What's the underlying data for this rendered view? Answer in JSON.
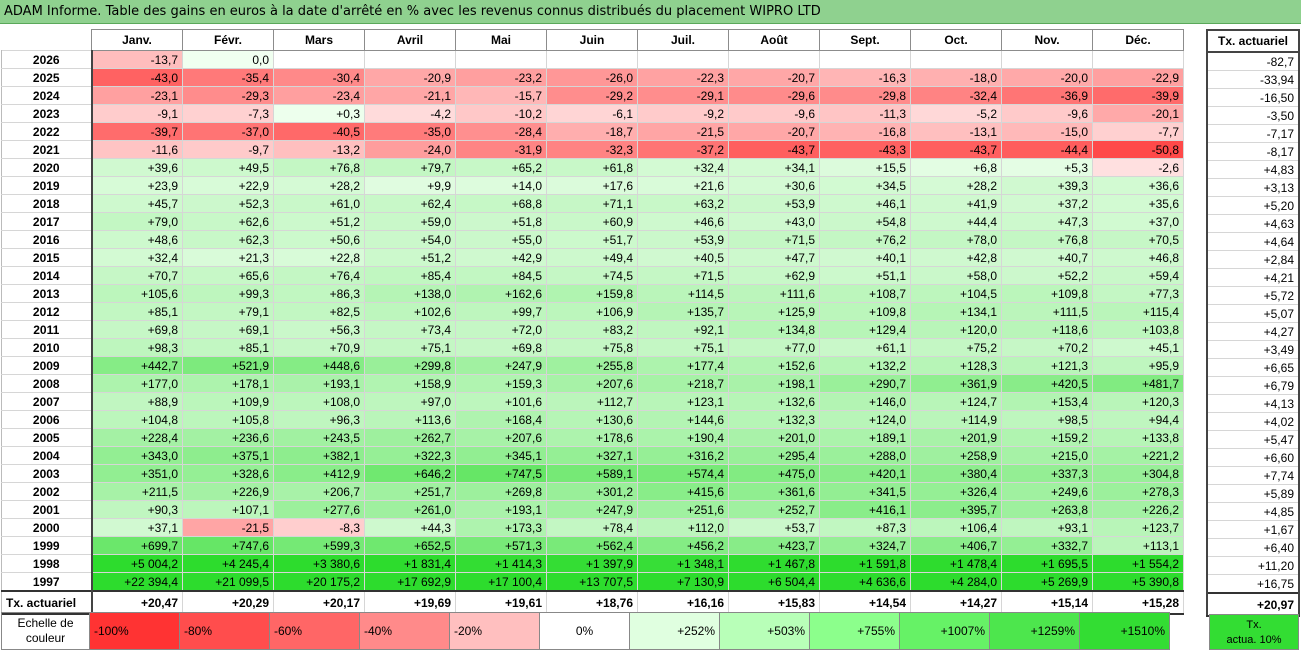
{
  "title": "ADAM Informe. Table des gains en euros à la date d'arrêté en % avec les revenus connus distribués du placement WIPRO LTD",
  "months": [
    "Janv.",
    "Févr.",
    "Mars",
    "Avril",
    "Mai",
    "Juin",
    "Juil.",
    "Août",
    "Sept.",
    "Oct.",
    "Nov.",
    "Déc."
  ],
  "side_header": "Tx. actuariel",
  "rows": [
    {
      "year": "2026",
      "v": [
        "-13,7",
        "0,0",
        "",
        "",
        "",
        "",
        "",
        "",
        "",
        "",
        "",
        ""
      ],
      "tx": "-82,7"
    },
    {
      "year": "2025",
      "v": [
        "-43,0",
        "-35,4",
        "-30,4",
        "-20,9",
        "-23,2",
        "-26,0",
        "-22,3",
        "-20,7",
        "-16,3",
        "-18,0",
        "-20,0",
        "-22,9"
      ],
      "tx": "-33,94"
    },
    {
      "year": "2024",
      "v": [
        "-23,1",
        "-29,3",
        "-23,4",
        "-21,1",
        "-15,7",
        "-29,2",
        "-29,1",
        "-29,6",
        "-29,8",
        "-32,4",
        "-36,9",
        "-39,9"
      ],
      "tx": "-16,50"
    },
    {
      "year": "2023",
      "v": [
        "-9,1",
        "-7,3",
        "+0,3",
        "-4,2",
        "-10,2",
        "-6,1",
        "-9,2",
        "-9,6",
        "-11,3",
        "-5,2",
        "-9,6",
        "-20,1"
      ],
      "tx": "-3,50"
    },
    {
      "year": "2022",
      "v": [
        "-39,7",
        "-37,0",
        "-40,5",
        "-35,0",
        "-28,4",
        "-18,7",
        "-21,5",
        "-20,7",
        "-16,8",
        "-13,1",
        "-15,0",
        "-7,7"
      ],
      "tx": "-7,17"
    },
    {
      "year": "2021",
      "v": [
        "-11,6",
        "-9,7",
        "-13,2",
        "-24,0",
        "-31,9",
        "-32,3",
        "-37,2",
        "-43,7",
        "-43,3",
        "-43,7",
        "-44,4",
        "-50,8"
      ],
      "tx": "-8,17"
    },
    {
      "year": "2020",
      "v": [
        "+39,6",
        "+49,5",
        "+76,8",
        "+79,7",
        "+65,2",
        "+61,8",
        "+32,4",
        "+34,1",
        "+15,5",
        "+6,8",
        "+5,3",
        "-2,6"
      ],
      "tx": "+4,83"
    },
    {
      "year": "2019",
      "v": [
        "+23,9",
        "+22,9",
        "+28,2",
        "+9,9",
        "+14,0",
        "+17,6",
        "+21,6",
        "+30,6",
        "+34,5",
        "+28,2",
        "+39,3",
        "+36,6"
      ],
      "tx": "+3,13"
    },
    {
      "year": "2018",
      "v": [
        "+45,7",
        "+52,3",
        "+61,0",
        "+62,4",
        "+68,8",
        "+71,1",
        "+63,2",
        "+53,9",
        "+46,1",
        "+41,9",
        "+37,2",
        "+35,6"
      ],
      "tx": "+5,20"
    },
    {
      "year": "2017",
      "v": [
        "+79,0",
        "+62,6",
        "+51,2",
        "+59,0",
        "+51,8",
        "+60,9",
        "+46,6",
        "+43,0",
        "+54,8",
        "+44,4",
        "+47,3",
        "+37,0"
      ],
      "tx": "+4,63"
    },
    {
      "year": "2016",
      "v": [
        "+48,6",
        "+62,3",
        "+50,6",
        "+54,0",
        "+55,0",
        "+51,7",
        "+53,9",
        "+71,5",
        "+76,2",
        "+78,0",
        "+76,8",
        "+70,5"
      ],
      "tx": "+4,64"
    },
    {
      "year": "2015",
      "v": [
        "+32,4",
        "+21,3",
        "+22,8",
        "+51,2",
        "+42,9",
        "+49,4",
        "+40,5",
        "+47,7",
        "+40,1",
        "+42,8",
        "+40,7",
        "+46,8"
      ],
      "tx": "+2,84"
    },
    {
      "year": "2014",
      "v": [
        "+70,7",
        "+65,6",
        "+76,4",
        "+85,4",
        "+84,5",
        "+74,5",
        "+71,5",
        "+62,9",
        "+51,1",
        "+58,0",
        "+52,2",
        "+59,4"
      ],
      "tx": "+4,21"
    },
    {
      "year": "2013",
      "v": [
        "+105,6",
        "+99,3",
        "+86,3",
        "+138,0",
        "+162,6",
        "+159,8",
        "+114,5",
        "+111,6",
        "+108,7",
        "+104,5",
        "+109,8",
        "+77,3"
      ],
      "tx": "+5,72"
    },
    {
      "year": "2012",
      "v": [
        "+85,1",
        "+79,1",
        "+82,5",
        "+102,6",
        "+99,7",
        "+106,9",
        "+135,7",
        "+125,9",
        "+109,8",
        "+134,1",
        "+111,5",
        "+115,4"
      ],
      "tx": "+5,07"
    },
    {
      "year": "2011",
      "v": [
        "+69,8",
        "+69,1",
        "+56,3",
        "+73,4",
        "+72,0",
        "+83,2",
        "+92,1",
        "+134,8",
        "+129,4",
        "+120,0",
        "+118,6",
        "+103,8"
      ],
      "tx": "+4,27"
    },
    {
      "year": "2010",
      "v": [
        "+98,3",
        "+85,1",
        "+70,9",
        "+75,1",
        "+69,8",
        "+75,8",
        "+75,1",
        "+77,0",
        "+61,1",
        "+75,2",
        "+70,2",
        "+45,1"
      ],
      "tx": "+3,49"
    },
    {
      "year": "2009",
      "v": [
        "+442,7",
        "+521,9",
        "+448,6",
        "+299,8",
        "+247,9",
        "+255,8",
        "+177,4",
        "+152,6",
        "+132,2",
        "+128,3",
        "+121,3",
        "+95,9"
      ],
      "tx": "+6,65"
    },
    {
      "year": "2008",
      "v": [
        "+177,0",
        "+178,1",
        "+193,1",
        "+158,9",
        "+159,3",
        "+207,6",
        "+218,7",
        "+198,1",
        "+290,7",
        "+361,9",
        "+420,5",
        "+481,7"
      ],
      "tx": "+6,79"
    },
    {
      "year": "2007",
      "v": [
        "+88,9",
        "+109,9",
        "+108,0",
        "+97,0",
        "+101,6",
        "+112,7",
        "+123,1",
        "+132,6",
        "+146,0",
        "+124,7",
        "+153,4",
        "+120,3"
      ],
      "tx": "+4,13"
    },
    {
      "year": "2006",
      "v": [
        "+104,8",
        "+105,8",
        "+96,3",
        "+113,6",
        "+168,4",
        "+130,6",
        "+144,6",
        "+132,3",
        "+124,0",
        "+114,9",
        "+98,5",
        "+94,4"
      ],
      "tx": "+4,02"
    },
    {
      "year": "2005",
      "v": [
        "+228,4",
        "+236,6",
        "+243,5",
        "+262,7",
        "+207,6",
        "+178,6",
        "+190,4",
        "+201,0",
        "+189,1",
        "+201,9",
        "+159,2",
        "+133,8"
      ],
      "tx": "+5,47"
    },
    {
      "year": "2004",
      "v": [
        "+343,0",
        "+375,1",
        "+382,1",
        "+322,3",
        "+345,1",
        "+327,1",
        "+316,2",
        "+295,4",
        "+288,0",
        "+258,9",
        "+215,0",
        "+221,2"
      ],
      "tx": "+6,60"
    },
    {
      "year": "2003",
      "v": [
        "+351,0",
        "+328,6",
        "+412,9",
        "+646,2",
        "+747,5",
        "+589,1",
        "+574,4",
        "+475,0",
        "+420,1",
        "+380,4",
        "+337,3",
        "+304,8"
      ],
      "tx": "+7,74"
    },
    {
      "year": "2002",
      "v": [
        "+211,5",
        "+226,9",
        "+206,7",
        "+251,7",
        "+269,8",
        "+301,2",
        "+415,6",
        "+361,6",
        "+341,5",
        "+326,4",
        "+249,6",
        "+278,3"
      ],
      "tx": "+5,89"
    },
    {
      "year": "2001",
      "v": [
        "+90,3",
        "+107,1",
        "+277,6",
        "+261,0",
        "+193,1",
        "+247,9",
        "+251,6",
        "+252,7",
        "+416,1",
        "+395,7",
        "+263,8",
        "+226,2"
      ],
      "tx": "+4,85"
    },
    {
      "year": "2000",
      "v": [
        "+37,1",
        "-21,5",
        "-8,3",
        "+44,3",
        "+173,3",
        "+78,4",
        "+112,0",
        "+53,7",
        "+87,3",
        "+106,4",
        "+93,1",
        "+123,7"
      ],
      "tx": "+1,67"
    },
    {
      "year": "1999",
      "v": [
        "+699,7",
        "+747,6",
        "+599,3",
        "+652,5",
        "+571,3",
        "+562,4",
        "+456,2",
        "+423,7",
        "+324,7",
        "+406,7",
        "+332,7",
        "+113,1"
      ],
      "tx": "+6,40"
    },
    {
      "year": "1998",
      "v": [
        "+5 004,2",
        "+4 245,4",
        "+3 380,6",
        "+1 831,4",
        "+1 414,3",
        "+1 397,9",
        "+1 348,1",
        "+1 467,8",
        "+1 591,8",
        "+1 478,4",
        "+1 695,5",
        "+1 554,2"
      ],
      "tx": "+11,20"
    },
    {
      "year": "1997",
      "v": [
        "+22 394,4",
        "+21 099,5",
        "+20 175,2",
        "+17 692,9",
        "+17 100,4",
        "+13 707,5",
        "+7 130,9",
        "+6 504,4",
        "+4 636,6",
        "+4 284,0",
        "+5 269,9",
        "+5 390,8"
      ],
      "tx": "+16,75"
    }
  ],
  "footer": {
    "label": "Tx. actuariel",
    "v": [
      "+20,47",
      "+20,29",
      "+20,17",
      "+19,69",
      "+19,61",
      "+18,76",
      "+16,16",
      "+15,83",
      "+14,54",
      "+14,27",
      "+15,14",
      "+15,28"
    ],
    "tx": "+20,97"
  },
  "legend": {
    "label_line1": "Echelle de",
    "label_line2": "couleur",
    "items": [
      {
        "text": "-100%",
        "color": "#ff3333",
        "align": "left"
      },
      {
        "text": "-80%",
        "color": "#ff4d4d",
        "align": "left"
      },
      {
        "text": "-60%",
        "color": "#ff6666",
        "align": "left"
      },
      {
        "text": "-40%",
        "color": "#ff8a8a",
        "align": "left"
      },
      {
        "text": "-20%",
        "color": "#ffbfbf",
        "align": "left"
      },
      {
        "text": "0%",
        "color": "#ffffff",
        "align": "center"
      },
      {
        "text": "+252%",
        "color": "#e0ffe0",
        "align": "right"
      },
      {
        "text": "+503%",
        "color": "#b8ffb8",
        "align": "right"
      },
      {
        "text": "+755%",
        "color": "#8cff8c",
        "align": "right"
      },
      {
        "text": "+1007%",
        "color": "#66f266",
        "align": "right"
      },
      {
        "text": "+1259%",
        "color": "#4de64d",
        "align": "right"
      },
      {
        "text": "+1510%",
        "color": "#33dd33",
        "align": "right"
      }
    ],
    "tx_line1": "Tx.",
    "tx_line2": "actua. 10%"
  }
}
